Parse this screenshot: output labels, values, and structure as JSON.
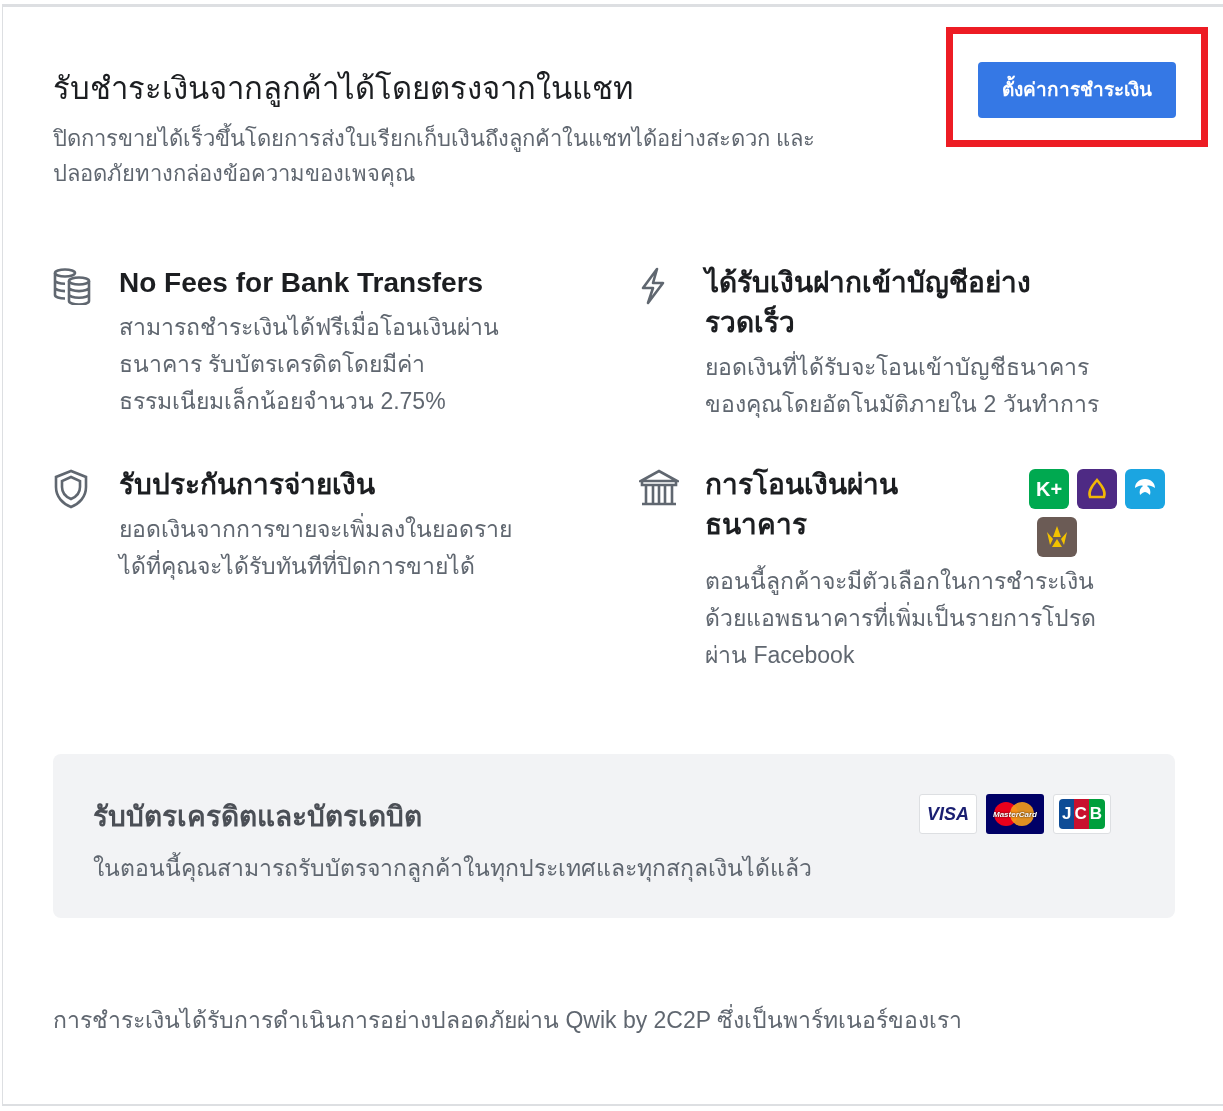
{
  "header": {
    "title": "รับชำระเงินจากลูกค้าได้โดยตรงจากในแชท",
    "subtitle": "ปิดการขายได้เร็วขึ้นโดยการส่งใบเรียกเก็บเงินถึงลูกค้าในแชทได้อย่างสะดวก และปลอดภัยทางกล่องข้อความของเพจคุณ",
    "button": "ตั้งค่าการชำระเงิน",
    "highlighted": true
  },
  "features": [
    {
      "title": "No Fees for Bank Transfers",
      "body": "สามารถชำระเงินได้ฟรีเมื่อโอนเงินผ่านธนาคาร รับบัตรเครดิตโดยมีค่าธรรมเนียมเล็กน้อยจำนวน 2.75%"
    },
    {
      "title": "ได้รับเงินฝากเข้าบัญชีอย่างรวดเร็ว",
      "body": "ยอดเงินที่ได้รับจะโอนเข้าบัญชีธนาคารของคุณโดยอัตโนมัติภายใน 2 วันทำการ"
    },
    {
      "title": "รับประกันการจ่ายเงิน",
      "body": "ยอดเงินจากการขายจะเพิ่มลงในยอดรายได้ที่คุณจะได้รับทันทีที่ปิดการขายได้"
    },
    {
      "title": "การโอนเงินผ่านธนาคาร",
      "body": "ตอนนี้ลูกค้าจะมีตัวเลือกในการชำระเงินด้วยแอพธนาคารที่เพิ่มเป็นรายการโปรดผ่าน Facebook",
      "bank_logos": [
        {
          "kind": "text",
          "label": "K+",
          "color": "#00a950"
        },
        {
          "kind": "arch",
          "color": "#4e2a84"
        },
        {
          "kind": "bird",
          "color": "#1ba5e1"
        },
        {
          "kind": "fan",
          "color": "#6b5b55"
        }
      ]
    }
  ],
  "cards_panel": {
    "title": "รับบัตรเครดิตและบัตรเดบิต",
    "body": "ในตอนนี้คุณสามารถรับบัตรจากลูกค้าในทุกประเทศและทุกสกุลเงินได้แล้ว",
    "cards": [
      {
        "kind": "visa",
        "label": "VISA"
      },
      {
        "kind": "mastercard",
        "label": "MasterCard"
      },
      {
        "kind": "jcb",
        "label": "JCB"
      }
    ]
  },
  "footer": "การชำระเงินได้รับการดำเนินการอย่างปลอดภัยผ่าน Qwik by 2C2P ซึ่งเป็นพาร์ทเนอร์ของเรา"
}
